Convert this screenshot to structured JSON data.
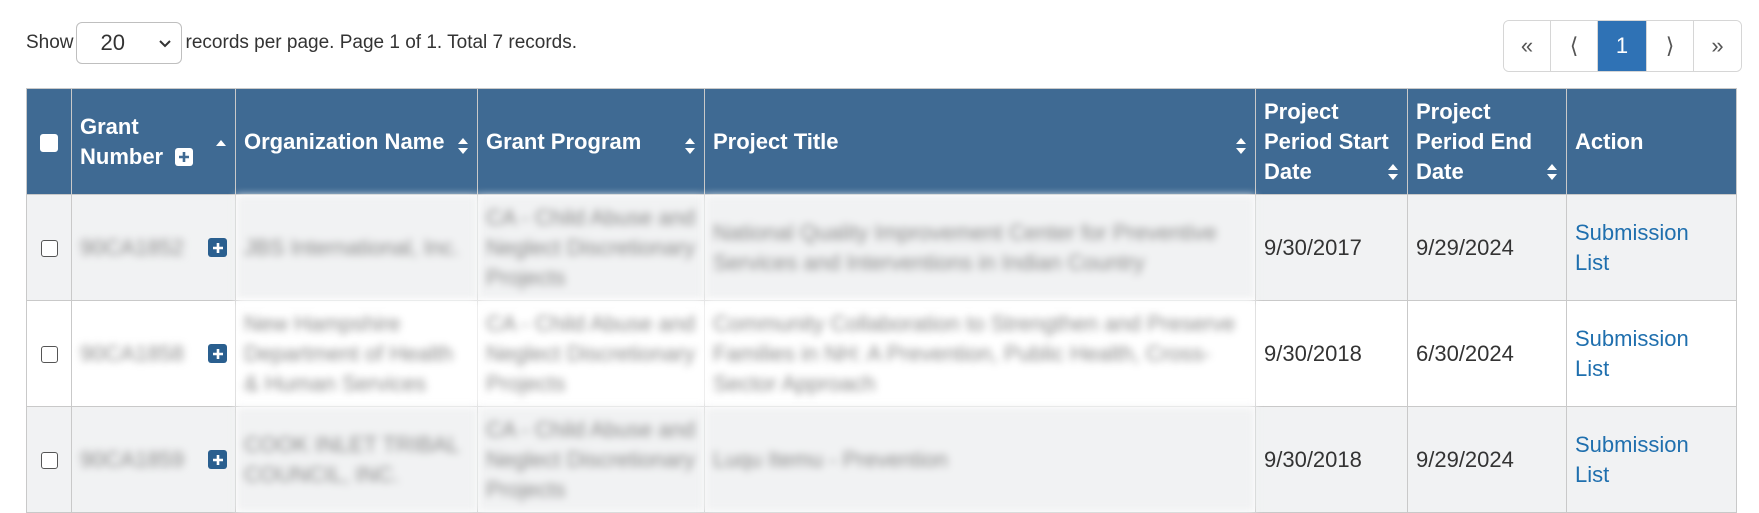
{
  "toolbar": {
    "show_label": "Show",
    "page_size": "20",
    "records_text": "records per page. Page 1 of 1. Total 7 records."
  },
  "pagination": {
    "first": "«",
    "prev": "⟨",
    "current": "1",
    "next": "⟩",
    "last": "»"
  },
  "table": {
    "headers": {
      "grant_number": [
        "Grant",
        "Number"
      ],
      "organization_name": "Organization Name",
      "grant_program": "Grant Program",
      "project_title": "Project Title",
      "start_date": [
        "Project",
        "Period Start",
        "Date"
      ],
      "end_date": [
        "Project",
        "Period End",
        "Date"
      ],
      "action": "Action"
    },
    "rows": [
      {
        "grant_number": "90CA1852",
        "organization_name": "JBS International, Inc.",
        "grant_program": "CA - Child Abuse and Neglect Discretionary Projects",
        "project_title": "National Quality Improvement Center for Preventive Services and Interventions in Indian Country",
        "start_date": "9/30/2017",
        "end_date": "9/29/2024",
        "action": "Submission List"
      },
      {
        "grant_number": "90CA1858",
        "organization_name": "New Hampshire Department of Health & Human Services",
        "grant_program": "CA - Child Abuse and Neglect Discretionary Projects",
        "project_title": "Community Collaboration to Strengthen and Preserve Families in NH: A Prevention, Public Health, Cross-Sector Approach",
        "start_date": "9/30/2018",
        "end_date": "6/30/2024",
        "action": "Submission List"
      },
      {
        "grant_number": "90CA1859",
        "organization_name": "COOK INLET TRIBAL COUNCIL, INC.",
        "grant_program": "CA - Child Abuse and Neglect Discretionary Projects",
        "project_title": "Luqu Itemu - Prevention",
        "start_date": "9/30/2018",
        "end_date": "9/29/2024",
        "action": "Submission List"
      }
    ]
  },
  "colors": {
    "header_bg": "#3f6a93",
    "accent": "#2f72b5",
    "link": "#1f6fae"
  },
  "icons": {
    "expand": "plus-box-icon",
    "sort": "sort-arrows-icon",
    "sort_asc": "sort-ascending-icon",
    "dropdown": "chevron-down-icon"
  }
}
